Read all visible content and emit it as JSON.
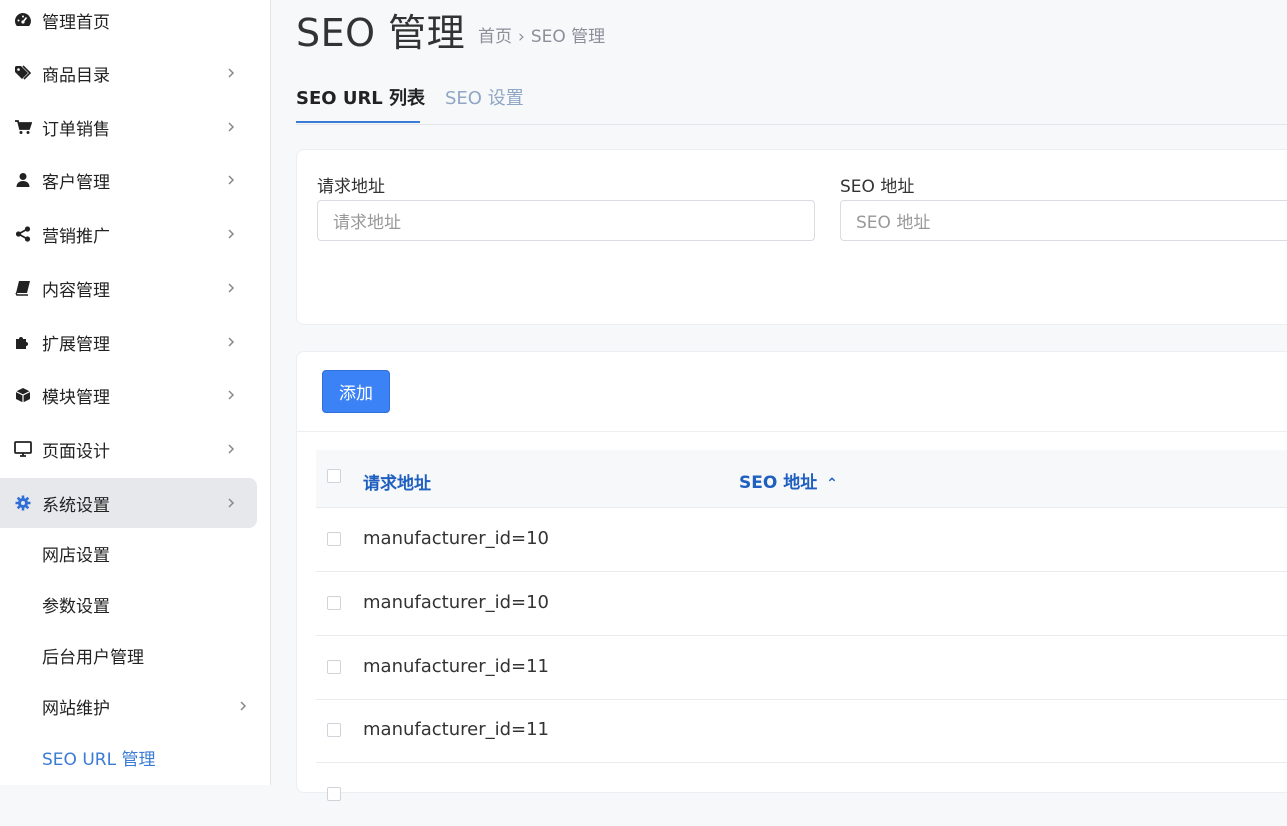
{
  "sidebar": {
    "items": [
      {
        "label": "管理首页",
        "icon": "dashboard-icon",
        "has_children": false
      },
      {
        "label": "商品目录",
        "icon": "tags-icon",
        "has_children": true
      },
      {
        "label": "订单销售",
        "icon": "cart-icon",
        "has_children": true
      },
      {
        "label": "客户管理",
        "icon": "user-icon",
        "has_children": true
      },
      {
        "label": "营销推广",
        "icon": "share-icon",
        "has_children": true
      },
      {
        "label": "内容管理",
        "icon": "book-icon",
        "has_children": true
      },
      {
        "label": "扩展管理",
        "icon": "puzzle-icon",
        "has_children": true
      },
      {
        "label": "模块管理",
        "icon": "cube-icon",
        "has_children": true
      },
      {
        "label": "页面设计",
        "icon": "monitor-icon",
        "has_children": true
      },
      {
        "label": "系统设置",
        "icon": "gear-icon",
        "has_children": true,
        "active": true
      }
    ],
    "sub_items": [
      {
        "label": "网店设置"
      },
      {
        "label": "参数设置"
      },
      {
        "label": "后台用户管理"
      },
      {
        "label": "网站维护",
        "has_children": true
      },
      {
        "label": "SEO URL 管理",
        "current": true
      }
    ]
  },
  "header": {
    "title": "SEO 管理",
    "breadcrumb": [
      "首页",
      "SEO 管理"
    ],
    "breadcrumb_sep": "›"
  },
  "tabs": [
    {
      "label": "SEO URL 列表",
      "active": true
    },
    {
      "label": "SEO 设置",
      "active": false
    }
  ],
  "filters": {
    "request_label": "请求地址",
    "request_placeholder": "请求地址",
    "seo_label": "SEO 地址",
    "seo_placeholder": "SEO 地址"
  },
  "list": {
    "add_label": "添加",
    "columns": [
      "请求地址",
      "SEO 地址"
    ],
    "sort_indicator": "⌃",
    "rows": [
      {
        "request": "manufacturer_id=10",
        "seo": ""
      },
      {
        "request": "manufacturer_id=10",
        "seo": ""
      },
      {
        "request": "manufacturer_id=11",
        "seo": ""
      },
      {
        "request": "manufacturer_id=11",
        "seo": ""
      }
    ]
  },
  "colors": {
    "accent": "#3b82f6",
    "link": "#3a7bd5",
    "header_text": "#1f5fbf"
  }
}
